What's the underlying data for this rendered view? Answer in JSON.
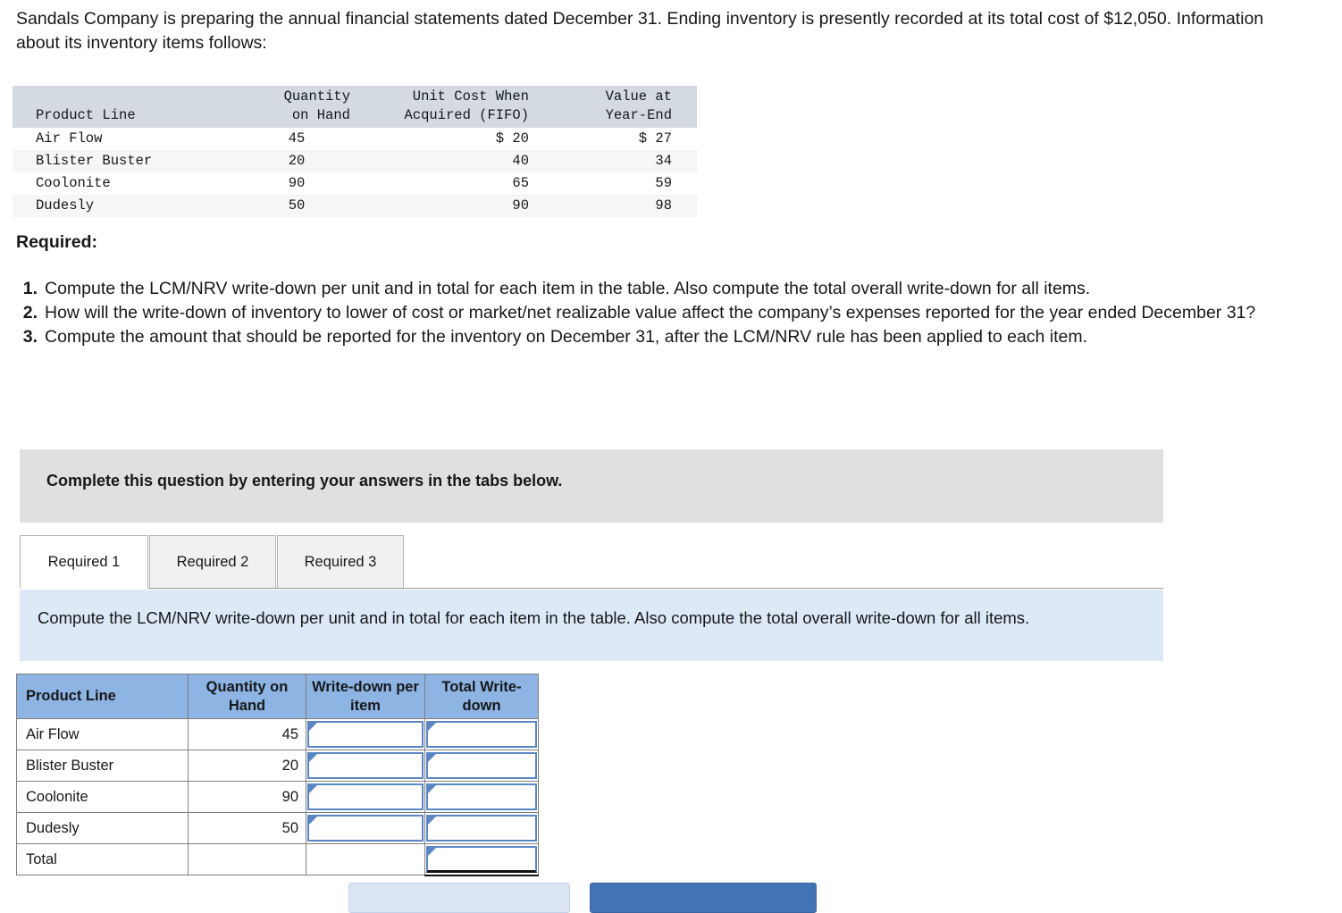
{
  "intro": {
    "paragraph": "Sandals Company is preparing the annual financial statements dated December 31. Ending inventory is presently recorded at its total cost of $12,050. Information about its inventory items follows:"
  },
  "inventory_table": {
    "headers": {
      "product_line": "Product Line",
      "quantity_on_hand": "Quantity\non Hand",
      "unit_cost": "Unit Cost When\nAcquired (FIFO)",
      "value_year_end": "Value at\nYear-End"
    },
    "rows": [
      {
        "product": "Air Flow",
        "qty": "45",
        "cost": "$ 20",
        "value": "$ 27"
      },
      {
        "product": "Blister Buster",
        "qty": "20",
        "cost": "40",
        "value": "34"
      },
      {
        "product": "Coolonite",
        "qty": "90",
        "cost": "65",
        "value": "59"
      },
      {
        "product": "Dudesly",
        "qty": "50",
        "cost": "90",
        "value": "98"
      }
    ]
  },
  "required": {
    "heading": "Required:",
    "items": [
      {
        "num": "1.",
        "text": "Compute the LCM/NRV write-down per unit and in total for each item in the table. Also compute the total overall write-down for all items."
      },
      {
        "num": "2.",
        "text": "How will the write-down of inventory to lower of cost or market/net realizable value affect the company’s expenses reported for the year ended December 31?"
      },
      {
        "num": "3.",
        "text": "Compute the amount that should be reported for the inventory on December 31, after the LCM/NRV rule has been applied to each item."
      }
    ]
  },
  "banner": {
    "text": "Complete this question by entering your answers in the tabs below."
  },
  "tabs": {
    "items": [
      {
        "label": "Required 1",
        "active": true
      },
      {
        "label": "Required 2",
        "active": false
      },
      {
        "label": "Required 3",
        "active": false
      }
    ]
  },
  "tab_instruction": {
    "text": "Compute the LCM/NRV write-down per unit and in total for each item in the table. Also compute the total overall write-down for all items."
  },
  "answer_table": {
    "headers": {
      "product_line": "Product Line",
      "quantity_on_hand": "Quantity on Hand",
      "write_down_per_item": "Write-down per item",
      "total_write_down": "Total Write-down"
    },
    "rows": [
      {
        "product": "Air Flow",
        "qty": "45",
        "write_down_per_item": "",
        "total_write_down": ""
      },
      {
        "product": "Blister Buster",
        "qty": "20",
        "write_down_per_item": "",
        "total_write_down": ""
      },
      {
        "product": "Coolonite",
        "qty": "90",
        "write_down_per_item": "",
        "total_write_down": ""
      },
      {
        "product": "Dudesly",
        "qty": "50",
        "write_down_per_item": "",
        "total_write_down": ""
      }
    ],
    "total_row": {
      "product": "Total",
      "qty": "",
      "write_down_per_item": "",
      "total_write_down": ""
    }
  },
  "footer_buttons": {
    "prev_label": "",
    "next_label": ""
  },
  "colors": {
    "data_header_bg": "#d4dae2",
    "data_alt_row_bg": "#f6f6f6",
    "banner_bg": "#e0e0e0",
    "instruction_bg": "#dde9f6",
    "answer_header_bg": "#8db4e2",
    "input_border": "#5a86c4",
    "next_button_bg": "#4273b5",
    "prev_button_bg": "#dbe5f1"
  }
}
